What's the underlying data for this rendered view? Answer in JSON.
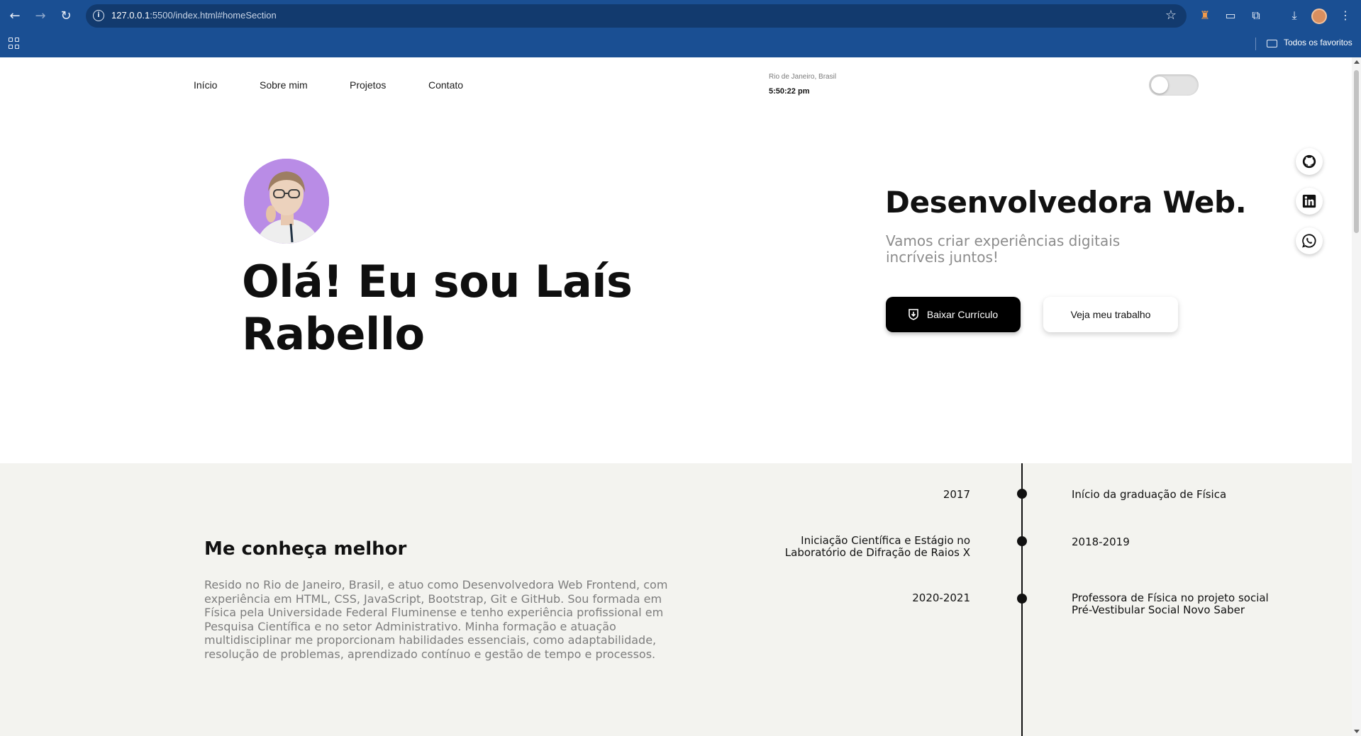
{
  "browser": {
    "url_host": "127.0.0.1",
    "url_rest": ":5500/index.html#homeSection",
    "bookmarks_label": "Todos os favoritos"
  },
  "nav": {
    "items": [
      "Início",
      "Sobre mim",
      "Projetos",
      "Contato"
    ]
  },
  "clock": {
    "city": "Rio de Janeiro, Brasil",
    "time": "5:50:22 pm"
  },
  "theme_toggle": {
    "state": "off"
  },
  "hero": {
    "greeting": "Olá! Eu sou Laís Rabello",
    "role": "Desenvolvedora Web.",
    "tagline": "Vamos criar experiências digitais incríveis juntos!",
    "primary_button": "Baixar Currículo",
    "secondary_button": "Veja meu trabalho"
  },
  "social": {
    "icons": [
      "github-icon",
      "linkedin-icon",
      "whatsapp-icon"
    ]
  },
  "about": {
    "title": "Me conheça melhor",
    "text": "Resido no Rio de Janeiro, Brasil, e atuo como Desenvolvedora Web Frontend, com experiência em HTML, CSS, JavaScript, Bootstrap, Git e GitHub. Sou formada em Física pela Universidade Federal Fluminense e tenho experiência profissional em Pesquisa Científica e no setor Administrativo. Minha formação e atuação multidisciplinar me proporcionam habilidades essenciais, como adaptabilidade, resolução de problemas, aprendizado contínuo e gestão de tempo e processos."
  },
  "timeline": {
    "entries": [
      {
        "left": "2017",
        "right": "Início da graduação de Física"
      },
      {
        "left": "Iniciação Científica e Estágio no Laboratório de Difração de Raios X",
        "right": "2018-2019"
      },
      {
        "left": "2020-2021",
        "right": "Professora de Física no projeto social Pré-Vestibular Social Novo Saber"
      }
    ]
  },
  "colors": {
    "browser_bar": "#1a4f93",
    "omnibox": "#123a6e",
    "section_bg": "#f3f3ef",
    "primary": "#000000",
    "muted_text": "#8c8c8c"
  }
}
